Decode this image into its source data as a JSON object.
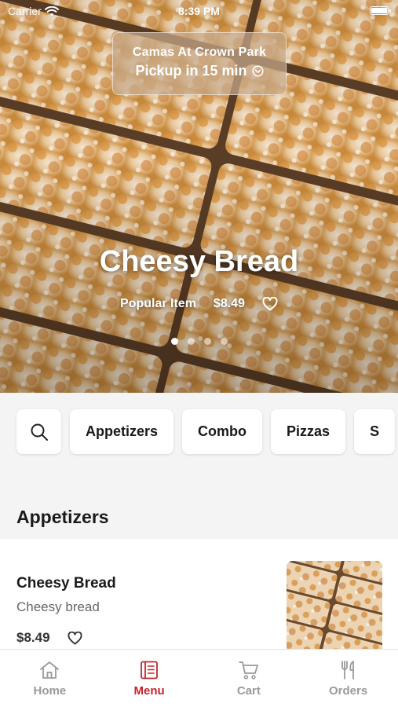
{
  "status_bar": {
    "carrier": "Carrier",
    "time": "8:39 PM"
  },
  "location": {
    "name": "Camas At Crown Park",
    "pickup": "Pickup in 15 min"
  },
  "hero": {
    "title": "Cheesy Bread",
    "tag": "Popular Item",
    "price": "$8.49",
    "slide_count": 4,
    "active_slide": 1
  },
  "categories": [
    "Appetizers",
    "Combo",
    "Pizzas",
    "S"
  ],
  "section": {
    "title": "Appetizers"
  },
  "item": {
    "name": "Cheesy Bread",
    "description": "Cheesy bread",
    "price": "$8.49"
  },
  "tabs": [
    {
      "label": "Home",
      "icon": "home-icon",
      "active": false
    },
    {
      "label": "Menu",
      "icon": "menu-icon",
      "active": true
    },
    {
      "label": "Cart",
      "icon": "cart-icon",
      "active": false
    },
    {
      "label": "Orders",
      "icon": "orders-icon",
      "active": false
    }
  ],
  "colors": {
    "accent": "#c4242b",
    "inactive_tab": "#9a9a9a"
  }
}
